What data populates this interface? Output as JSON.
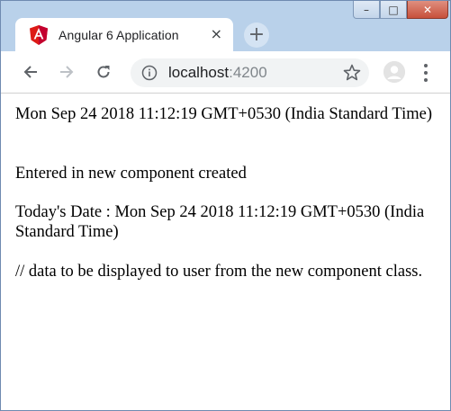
{
  "browser": {
    "tab_title": "Angular 6 Application",
    "tab_close": "×",
    "new_tab": "+",
    "url_host": "localhost",
    "url_port": ":4200",
    "window_controls": {
      "minimize": "–",
      "maximize": "□",
      "close": "✕"
    },
    "colors": {
      "frame": "#b9d1ea",
      "angular_red": "#dd1b16",
      "omnibox": "#f1f3f4"
    }
  },
  "page": {
    "lines": [
      "Mon Sep 24 2018 11:12:19 GMT+0530 (India Standard Time)",
      "Entered in new component created",
      "Today's Date : Mon Sep 24 2018 11:12:19 GMT+0530 (India Standard Time)",
      "// data to be displayed to user from the new component class."
    ]
  }
}
